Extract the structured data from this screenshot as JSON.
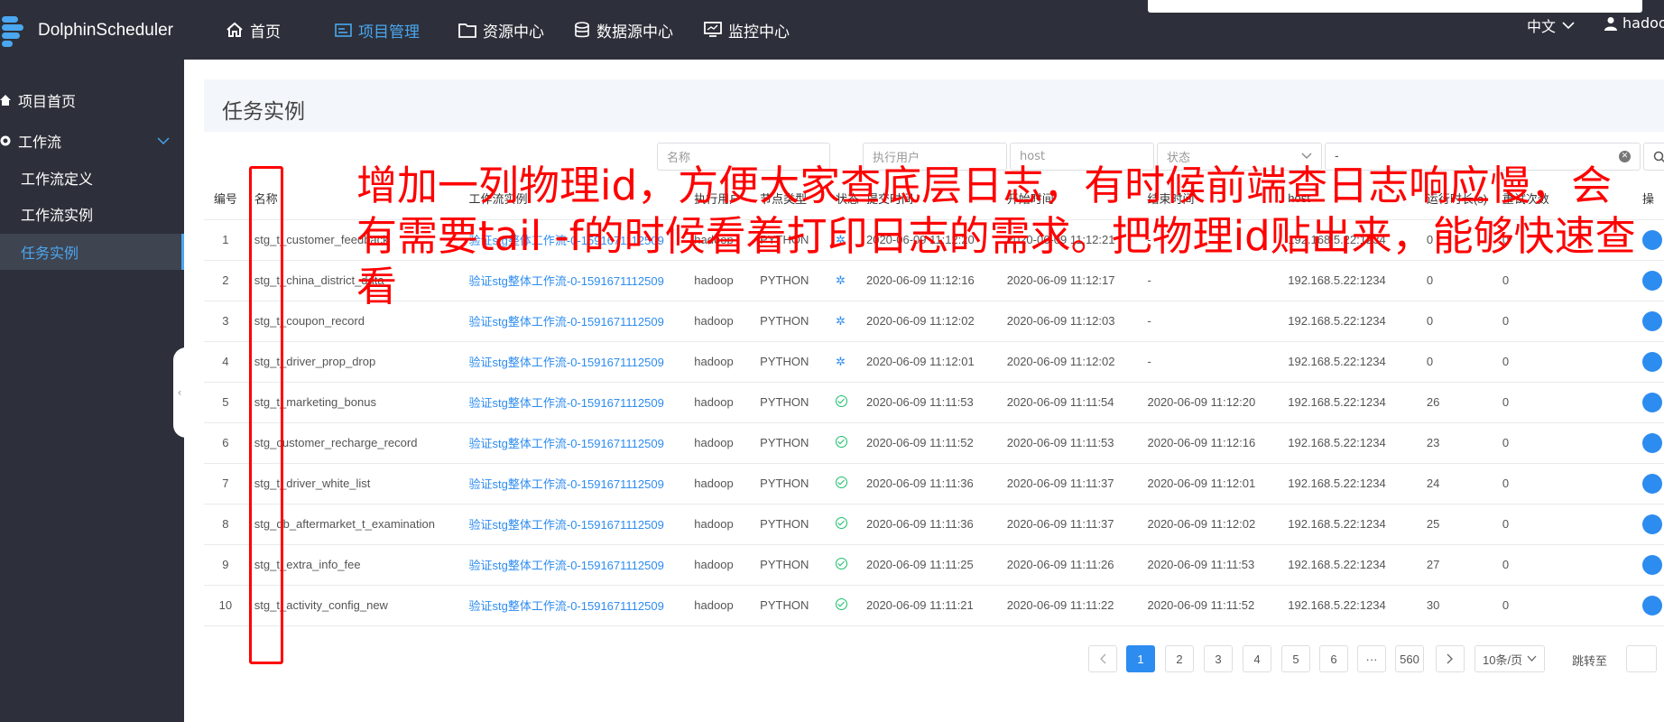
{
  "app": {
    "name": "DolphinScheduler"
  },
  "nav": {
    "items": [
      {
        "label": "首页"
      },
      {
        "label": "项目管理"
      },
      {
        "label": "资源中心"
      },
      {
        "label": "数据源中心"
      },
      {
        "label": "监控中心"
      }
    ],
    "language": "中文",
    "user": "hadoop"
  },
  "sidebar": {
    "items": [
      {
        "label": "项目首页"
      },
      {
        "label": "工作流"
      },
      {
        "label": "工作流定义"
      },
      {
        "label": "工作流实例"
      },
      {
        "label": "任务实例"
      }
    ]
  },
  "page": {
    "title": "任务实例"
  },
  "filters": {
    "name_placeholder": "名称",
    "user_placeholder": "执行用户",
    "host_placeholder": "host",
    "status_placeholder": "状态",
    "date_value": "-"
  },
  "table": {
    "headers": [
      "编号",
      "名称",
      "工作流实例",
      "执行用户",
      "节点类型",
      "状态",
      "提交时间",
      "开始时间",
      "结束时间",
      "host",
      "运行时长(s)",
      "重试次数",
      "操"
    ],
    "rows": [
      {
        "no": "1",
        "name": "stg_t_customer_feedback",
        "instance": "验证stg整体工作流-0-1591671112509",
        "user": "hadoop",
        "type": "PYTHON",
        "status": "running",
        "submit": "2020-06-09 11:12:20",
        "start": "2020-06-09 11:12:21",
        "end": "-",
        "host": "192.168.5.22:1234",
        "duration": "0",
        "retry": "0"
      },
      {
        "no": "2",
        "name": "stg_t_china_district_data",
        "instance": "验证stg整体工作流-0-1591671112509",
        "user": "hadoop",
        "type": "PYTHON",
        "status": "running",
        "submit": "2020-06-09 11:12:16",
        "start": "2020-06-09 11:12:17",
        "end": "-",
        "host": "192.168.5.22:1234",
        "duration": "0",
        "retry": "0"
      },
      {
        "no": "3",
        "name": "stg_t_coupon_record",
        "instance": "验证stg整体工作流-0-1591671112509",
        "user": "hadoop",
        "type": "PYTHON",
        "status": "running",
        "submit": "2020-06-09 11:12:02",
        "start": "2020-06-09 11:12:03",
        "end": "-",
        "host": "192.168.5.22:1234",
        "duration": "0",
        "retry": "0"
      },
      {
        "no": "4",
        "name": "stg_t_driver_prop_drop",
        "instance": "验证stg整体工作流-0-1591671112509",
        "user": "hadoop",
        "type": "PYTHON",
        "status": "running",
        "submit": "2020-06-09 11:12:01",
        "start": "2020-06-09 11:12:02",
        "end": "-",
        "host": "192.168.5.22:1234",
        "duration": "0",
        "retry": "0"
      },
      {
        "no": "5",
        "name": "stg_t_marketing_bonus",
        "instance": "验证stg整体工作流-0-1591671112509",
        "user": "hadoop",
        "type": "PYTHON",
        "status": "success",
        "submit": "2020-06-09 11:11:53",
        "start": "2020-06-09 11:11:54",
        "end": "2020-06-09 11:12:20",
        "host": "192.168.5.22:1234",
        "duration": "26",
        "retry": "0"
      },
      {
        "no": "6",
        "name": "stg_customer_recharge_record",
        "instance": "验证stg整体工作流-0-1591671112509",
        "user": "hadoop",
        "type": "PYTHON",
        "status": "success",
        "submit": "2020-06-09 11:11:52",
        "start": "2020-06-09 11:11:53",
        "end": "2020-06-09 11:12:16",
        "host": "192.168.5.22:1234",
        "duration": "23",
        "retry": "0"
      },
      {
        "no": "7",
        "name": "stg_t_driver_white_list",
        "instance": "验证stg整体工作流-0-1591671112509",
        "user": "hadoop",
        "type": "PYTHON",
        "status": "success",
        "submit": "2020-06-09 11:11:36",
        "start": "2020-06-09 11:11:37",
        "end": "2020-06-09 11:12:01",
        "host": "192.168.5.22:1234",
        "duration": "24",
        "retry": "0"
      },
      {
        "no": "8",
        "name": "stg_db_aftermarket_t_examination",
        "instance": "验证stg整体工作流-0-1591671112509",
        "user": "hadoop",
        "type": "PYTHON",
        "status": "success",
        "submit": "2020-06-09 11:11:36",
        "start": "2020-06-09 11:11:37",
        "end": "2020-06-09 11:12:02",
        "host": "192.168.5.22:1234",
        "duration": "25",
        "retry": "0"
      },
      {
        "no": "9",
        "name": "stg_t_extra_info_fee",
        "instance": "验证stg整体工作流-0-1591671112509",
        "user": "hadoop",
        "type": "PYTHON",
        "status": "success",
        "submit": "2020-06-09 11:11:25",
        "start": "2020-06-09 11:11:26",
        "end": "2020-06-09 11:11:53",
        "host": "192.168.5.22:1234",
        "duration": "27",
        "retry": "0"
      },
      {
        "no": "10",
        "name": "stg_t_activity_config_new",
        "instance": "验证stg整体工作流-0-1591671112509",
        "user": "hadoop",
        "type": "PYTHON",
        "status": "success",
        "submit": "2020-06-09 11:11:21",
        "start": "2020-06-09 11:11:22",
        "end": "2020-06-09 11:11:52",
        "host": "192.168.5.22:1234",
        "duration": "30",
        "retry": "0"
      }
    ]
  },
  "pagination": {
    "pages": [
      "1",
      "2",
      "3",
      "4",
      "5",
      "6",
      "···",
      "560"
    ],
    "current": "1",
    "page_size": "10条/页",
    "jump_label": "跳转至"
  },
  "annotation": {
    "text": "增加一列物理id，方便大家查底层日志，有时候前端查日志响应慢，会有需要tail -f的时候看着打印日志的需求。把物理id贴出来，能够快速查看",
    "color": "#ff0000"
  },
  "colors": {
    "accent": "#2d8cf0",
    "nav_bg": "#2d303a",
    "success": "#19be6b"
  }
}
